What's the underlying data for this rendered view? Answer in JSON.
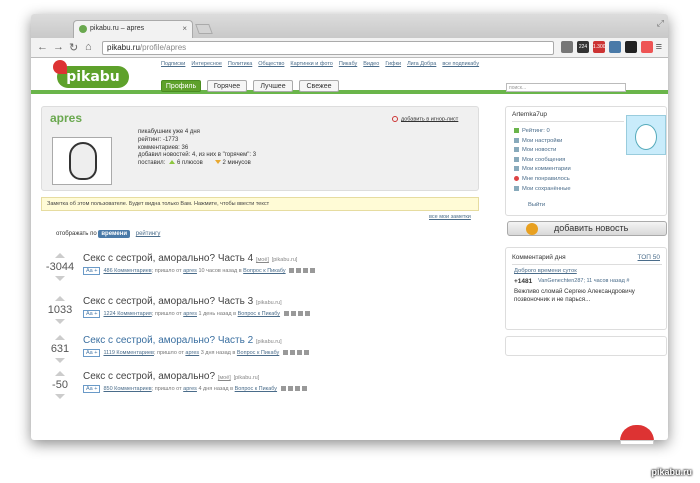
{
  "browser": {
    "tab_title": "pikabu.ru – apres",
    "url_host": "pikabu.ru",
    "url_path": "/profile/apres",
    "ext_badges": [
      "224",
      "1.300"
    ]
  },
  "site": {
    "logo": "pikabu",
    "topnav": [
      "Подписки",
      "Интересное",
      "Политика",
      "Общество",
      "Картинки и фото",
      "Пикабу",
      "Видео",
      "Гифки",
      "Лига Добра",
      "все подпикабу"
    ],
    "tabs": [
      "Профиль",
      "Горячее",
      "Лучшее",
      "Свежее"
    ],
    "search_placeholder": "поиск..."
  },
  "profile": {
    "name": "apres",
    "ignore_link": "добавить в игнор-лист",
    "since": "пикабушник уже 4 дня",
    "rating": "рейтинг: -1773",
    "comments": "комментариев: 36",
    "news": "добавил новостей: 4, из них в \"горячем\": 3",
    "votes_label": "поставил:",
    "plus": "6 плюсов",
    "minus": "2 минусов"
  },
  "note": {
    "text": "Заметка об этом пользователе. Будет видна только Вам. Нажмите, чтобы ввести текст",
    "all_notes": "все мои заметки"
  },
  "sort": {
    "label": "отображать по",
    "selected": "времени",
    "other": "рейтингу"
  },
  "posts": [
    {
      "rating": "-3044",
      "title": "Секс с сестрой, аморально? Часть 4",
      "tag": "[моё]",
      "src": "[pikabu.ru]",
      "aa": "Aa +",
      "comments": "486 Комментариев",
      "pre": "; пришло от",
      "author": "apres",
      "ago": "10 часов назад в",
      "cat": "Вопрос к Пикабу"
    },
    {
      "rating": "1033",
      "title": "Секс с сестрой, аморально? Часть 3",
      "tag": "",
      "src": "[pikabu.ru]",
      "aa": "Aa +",
      "comments": "1224 Комментария",
      "pre": "; пришло от",
      "author": "apres",
      "ago": "1 день назад в",
      "cat": "Вопрос к Пикабу"
    },
    {
      "rating": "631",
      "title": "Секс с сестрой, аморально? Часть 2",
      "tag": "",
      "src": "[pikabu.ru]",
      "aa": "Aa +",
      "comments": "1119 Комментариев",
      "pre": "; пришло от",
      "author": "apres",
      "ago": "3 дня назад в",
      "cat": "Вопрос к Пикабу"
    },
    {
      "rating": "-50",
      "title": "Секс с сестрой, аморально?",
      "tag": "[моё]",
      "src": "[pikabu.ru]",
      "aa": "Aa +",
      "comments": "850 Комментариев",
      "pre": "; пришло от",
      "author": "apres",
      "ago": "4 дня назад в",
      "cat": "Вопрос к Пикабу"
    }
  ],
  "user": {
    "name": "Artemka7up",
    "menu": [
      "Рейтинг: 0",
      "Мои настройки",
      "Мои новости",
      "Мои сообщения",
      "Мои комментарии",
      "Мне понравилось",
      "Мои сохранённые"
    ],
    "logout": "Выйти"
  },
  "add_news": "добавить новость",
  "comment_of_day": {
    "title": "Комментарий дня",
    "top": "ТОП 50",
    "best": "Доброго времени суток",
    "score": "+1481",
    "user": "VanGenechten287; 11 часов назад",
    "hash": "#",
    "text": "Вежливо сломай Сергею Александровичу позвоночник и не парься..."
  },
  "watermark": "pikabu.ru"
}
